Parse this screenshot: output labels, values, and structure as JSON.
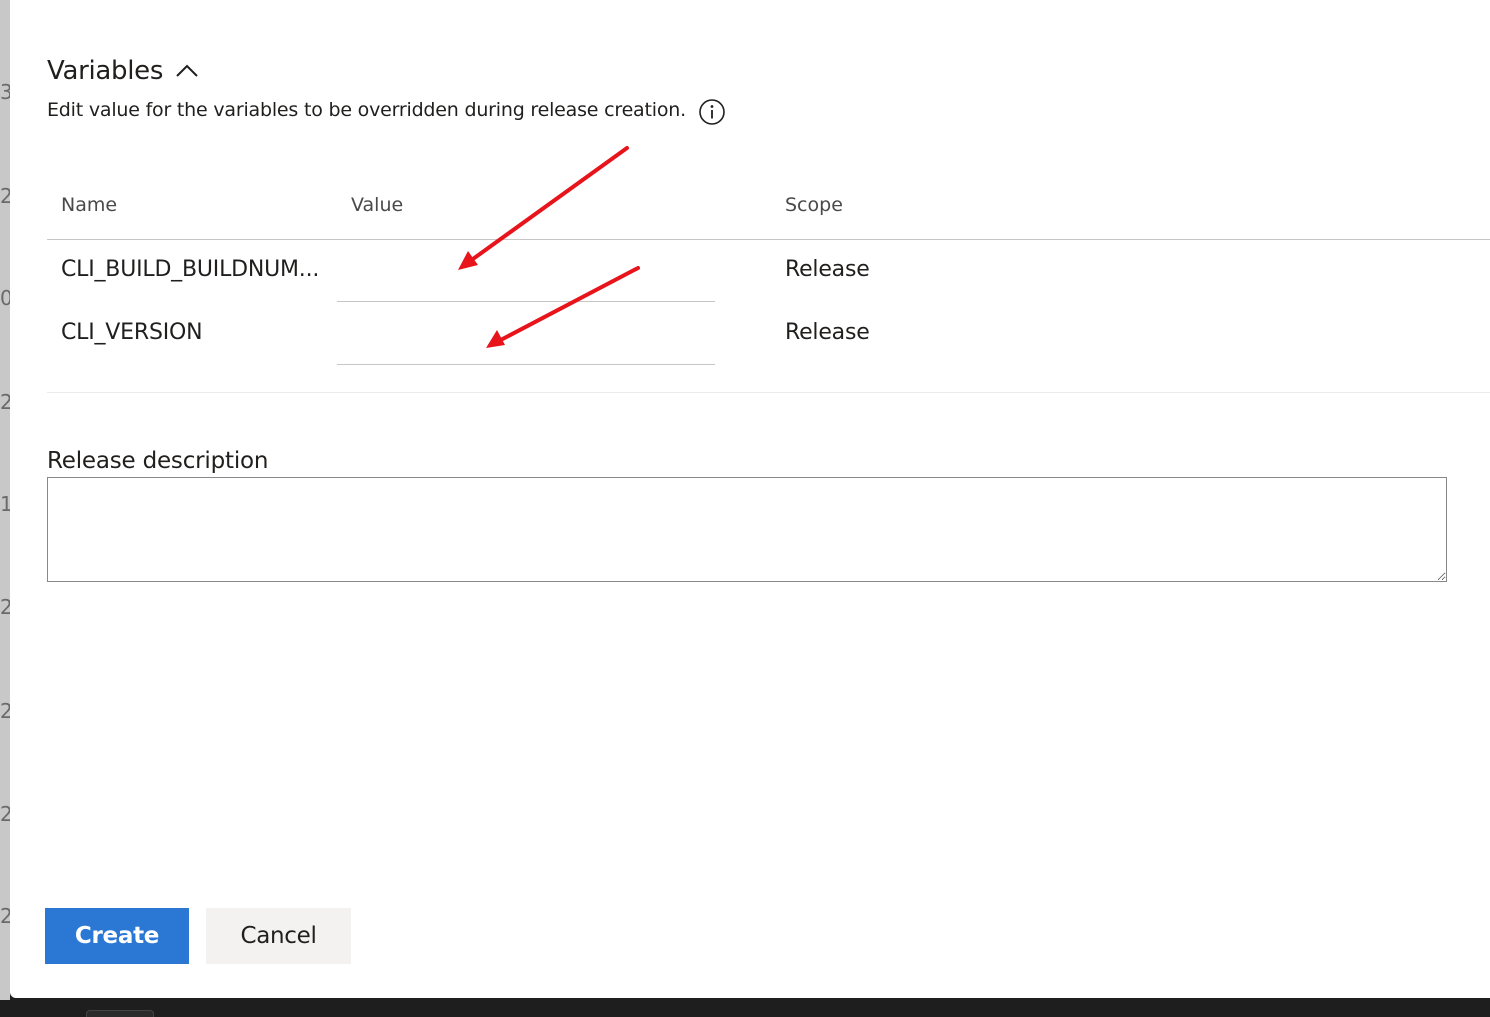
{
  "background_strip": {
    "glyphs": [
      "3",
      "2",
      "0",
      "2",
      "1",
      "2",
      "2",
      "2",
      "2"
    ]
  },
  "variables": {
    "title": "Variables",
    "toggle_icon": "chevron-up-icon",
    "subtitle": "Edit value for the variables to be overridden during release creation.",
    "info_icon": "info-icon",
    "columns": {
      "name": "Name",
      "value": "Value",
      "scope": "Scope"
    },
    "rows": [
      {
        "name": "CLI_BUILD_BUILDNUM...",
        "value": "",
        "scope": "Release"
      },
      {
        "name": "CLI_VERSION",
        "value": "",
        "scope": "Release"
      }
    ]
  },
  "release_description": {
    "label": "Release description",
    "value": ""
  },
  "actions": {
    "create_label": "Create",
    "cancel_label": "Cancel"
  },
  "colors": {
    "primary": "#2b77d4",
    "annotation_arrow": "#e8141b"
  }
}
